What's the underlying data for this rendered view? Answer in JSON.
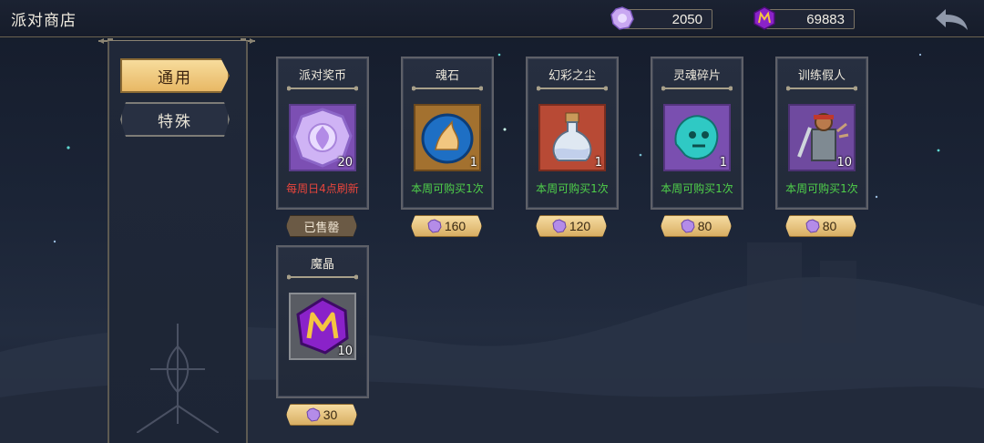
{
  "header": {
    "title": "派对商店"
  },
  "currencies": [
    {
      "icon": "party-coin-icon",
      "value": "2050"
    },
    {
      "icon": "magic-crystal-icon",
      "value": "69883"
    }
  ],
  "tabs": [
    {
      "label": "通用",
      "active": true
    },
    {
      "label": "特殊",
      "active": false
    }
  ],
  "items": [
    {
      "name": "派对奖币",
      "icon": "party-coin-icon",
      "quantity": "20",
      "note": "每周日4点刷新",
      "note_color": "#e8453c",
      "status": "已售罄",
      "price": null
    },
    {
      "name": "魂石",
      "icon": "soul-stone-icon",
      "quantity": "1",
      "note": "本周可购买1次",
      "note_color": "#4fd04a",
      "status": null,
      "price": "160"
    },
    {
      "name": "幻彩之尘",
      "icon": "potion-bottle-icon",
      "quantity": "1",
      "note": "本周可购买1次",
      "note_color": "#4fd04a",
      "status": null,
      "price": "120"
    },
    {
      "name": "灵魂碎片",
      "icon": "spirit-fragment-icon",
      "quantity": "1",
      "note": "本周可购买1次",
      "note_color": "#4fd04a",
      "status": null,
      "price": "80"
    },
    {
      "name": "训练假人",
      "icon": "training-dummy-icon",
      "quantity": "10",
      "note": "本周可购买1次",
      "note_color": "#4fd04a",
      "status": null,
      "price": "80"
    },
    {
      "name": "魔晶",
      "icon": "magic-crystal-icon",
      "quantity": "10",
      "note": "",
      "note_color": "#4fd04a",
      "status": null,
      "price": "30"
    }
  ],
  "colors": {
    "gold": "#e8b865",
    "accent_purple": "#b58bf0"
  }
}
